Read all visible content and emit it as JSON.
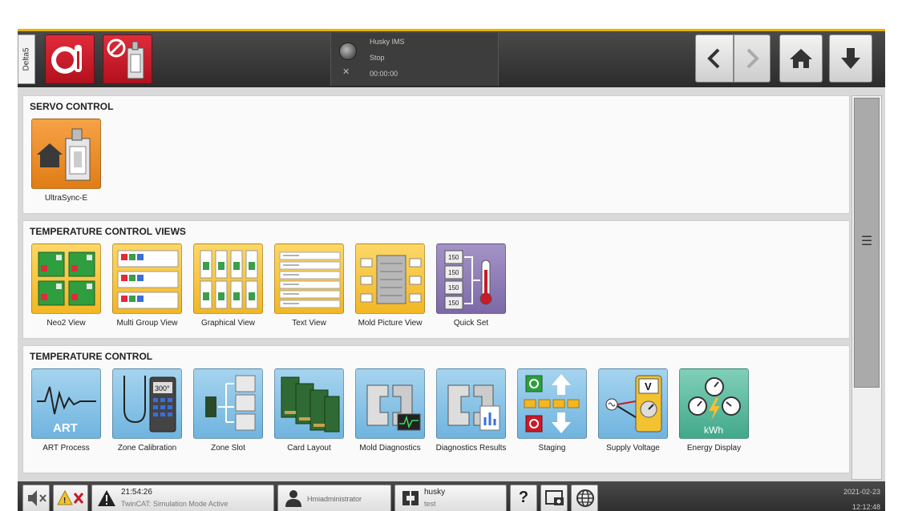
{
  "header": {
    "side_tab": "Delta5",
    "status": {
      "machine": "Husky IMS",
      "state": "Stop",
      "timer": "00:00:00"
    },
    "colors": {
      "accent": "#e8b500",
      "alarm_red": "#c81a28"
    }
  },
  "sections": [
    {
      "title": "SERVO CONTROL",
      "tiles": [
        {
          "label": "UltraSync-E",
          "color": "orange",
          "icon": "ultrasync-icon"
        }
      ]
    },
    {
      "title": "TEMPERATURE CONTROL VIEWS",
      "tiles": [
        {
          "label": "Neo2 View",
          "color": "yellow",
          "icon": "neo2-view-icon"
        },
        {
          "label": "Multi Group View",
          "color": "yellow",
          "icon": "multi-group-icon"
        },
        {
          "label": "Graphical View",
          "color": "yellow",
          "icon": "graphical-view-icon"
        },
        {
          "label": "Text View",
          "color": "yellow",
          "icon": "text-view-icon"
        },
        {
          "label": "Mold Picture View",
          "color": "yellow",
          "icon": "mold-picture-icon"
        },
        {
          "label": "Quick Set",
          "color": "purple",
          "icon": "quick-set-icon"
        }
      ]
    },
    {
      "title": "TEMPERATURE CONTROL",
      "tiles": [
        {
          "label": "ART Process",
          "color": "blue",
          "icon": "art-process-icon"
        },
        {
          "label": "Zone Calibration",
          "color": "blue",
          "icon": "zone-calibration-icon"
        },
        {
          "label": "Zone Slot",
          "color": "blue",
          "icon": "zone-slot-icon"
        },
        {
          "label": "Card Layout",
          "color": "blue",
          "icon": "card-layout-icon"
        },
        {
          "label": "Mold Diagnostics",
          "color": "blue",
          "icon": "mold-diagnostics-icon"
        },
        {
          "label": "Diagnostics Results",
          "color": "blue",
          "icon": "diagnostics-results-icon"
        },
        {
          "label": "Staging",
          "color": "blue",
          "icon": "staging-icon"
        },
        {
          "label": "Supply Voltage",
          "color": "blue",
          "icon": "supply-voltage-icon"
        },
        {
          "label": "Energy Display",
          "color": "green",
          "icon": "energy-display-icon"
        }
      ]
    }
  ],
  "tile_texts": {
    "art": "ART",
    "zone_calibration": "300°",
    "supply_voltage": "V",
    "energy": "kWh",
    "quickset_values": [
      "150",
      "150",
      "150",
      "150"
    ]
  },
  "footer": {
    "alarm_time": "21:54:26",
    "alarm_text": "TwinCAT: Simulation Mode Active",
    "user": "Hmiadministrator",
    "mold_name": "husky",
    "mold_sub": "test",
    "date": "2021-02-23",
    "time": "12:12:48"
  }
}
